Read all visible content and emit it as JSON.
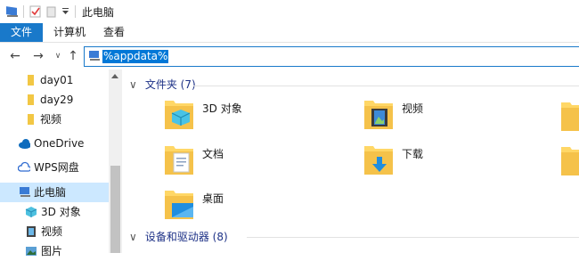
{
  "window": {
    "title": "此电脑"
  },
  "ribbon": {
    "tabs": [
      {
        "label": "文件",
        "active": true
      },
      {
        "label": "计算机",
        "active": false
      },
      {
        "label": "查看",
        "active": false
      }
    ]
  },
  "address": {
    "value": "%appdata%"
  },
  "nav": {
    "items": [
      {
        "label": "day01",
        "icon": "folder-icon"
      },
      {
        "label": "day29",
        "icon": "folder-icon"
      },
      {
        "label": "视频",
        "icon": "folder-icon"
      },
      {
        "label": "OneDrive",
        "icon": "cloud-icon"
      },
      {
        "label": "WPS网盘",
        "icon": "cloud-outline-icon"
      },
      {
        "label": "此电脑",
        "icon": "computer-icon",
        "selected": true
      },
      {
        "label": "3D 对象",
        "icon": "cube-icon"
      },
      {
        "label": "视频",
        "icon": "video-icon"
      },
      {
        "label": "图片",
        "icon": "picture-icon"
      }
    ]
  },
  "main": {
    "folders_group": "文件夹 (7)",
    "folders": [
      {
        "label": "3D 对象",
        "icon": "folder-3d-icon"
      },
      {
        "label": "视频",
        "icon": "folder-video-icon"
      },
      {
        "label": "文档",
        "icon": "folder-docs-icon"
      },
      {
        "label": "下载",
        "icon": "folder-download-icon"
      },
      {
        "label": "桌面",
        "icon": "folder-desktop-icon"
      }
    ],
    "devices_group": "设备和驱动器 (8)"
  },
  "colors": {
    "accent": "#1979ca",
    "selection": "#0078d7",
    "nav_selected": "#cce8ff",
    "group_text": "#1e3287",
    "folder": "#ffd766"
  }
}
